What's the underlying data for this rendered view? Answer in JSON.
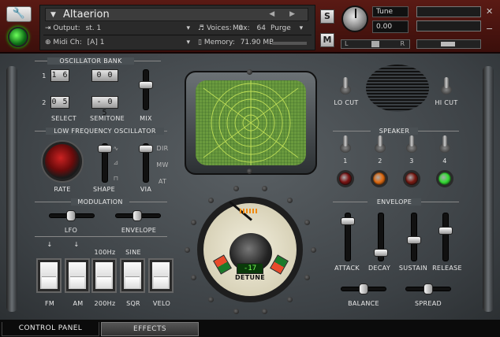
{
  "header": {
    "instrument_name": "Altaerion",
    "output_label": "Output:",
    "output_value": "st. 1",
    "midi_label": "Midi Ch:",
    "midi_value": "[A] 1",
    "voices_label": "Voices:",
    "voices_value": "0",
    "max_label": "Max:",
    "max_value": "64",
    "memory_label": "Memory:",
    "memory_value": "71.90 MB",
    "purge_label": "Purge",
    "solo_label": "S",
    "mute_label": "M",
    "tune_label": "Tune",
    "tune_value": "0.00",
    "pan_left": "L",
    "pan_right": "R"
  },
  "oscillator_bank": {
    "title": "OSCILLATOR BANK",
    "row1_label": "1",
    "row2_label": "2",
    "osc1_select": "1 6",
    "osc1_semitone": "0 0",
    "osc2_select": "0 5",
    "osc2_semitone": "- 0 5",
    "select_label": "SELECT",
    "semitone_label": "SEMITONE",
    "mix_label": "MIX",
    "mix_level": 0.35
  },
  "lfo": {
    "title": "LOW FREQUENCY OSCILLATOR",
    "rate_label": "RATE",
    "shape_label": "SHAPE",
    "via_label": "VIA",
    "dir_label": "DIR",
    "mw_label": "MW",
    "at_label": "AT"
  },
  "modulation": {
    "title": "MODULATION",
    "lfo_label": "LFO",
    "envelope_label": "ENVELOPE",
    "top_labels": [
      "↓",
      "↓",
      "100Hz",
      "SINE"
    ],
    "buttons": [
      "FM",
      "AM",
      "200Hz",
      "SQR",
      "VELO"
    ]
  },
  "detune": {
    "label": "DETUNE",
    "value": "-17"
  },
  "filters": {
    "lo_cut_label": "LO CUT",
    "hi_cut_label": "HI CUT"
  },
  "speaker": {
    "title": "SPEAKER",
    "numbers": [
      "1",
      "2",
      "3",
      "4"
    ],
    "lamp_colors": [
      "#7a1212",
      "#e06a10",
      "#7a1a12",
      "#33dd33"
    ]
  },
  "envelope": {
    "title": "ENVELOPE",
    "attack_label": "ATTACK",
    "decay_label": "DECAY",
    "sustain_label": "SUSTAIN",
    "release_label": "RELEASE",
    "balance_label": "BALANCE",
    "spread_label": "SPREAD"
  },
  "tabs": {
    "control_panel": "CONTROL PANEL",
    "effects": "EFFECTS"
  },
  "icons": {
    "settings": "wrench-icon",
    "power": "power-icon"
  }
}
